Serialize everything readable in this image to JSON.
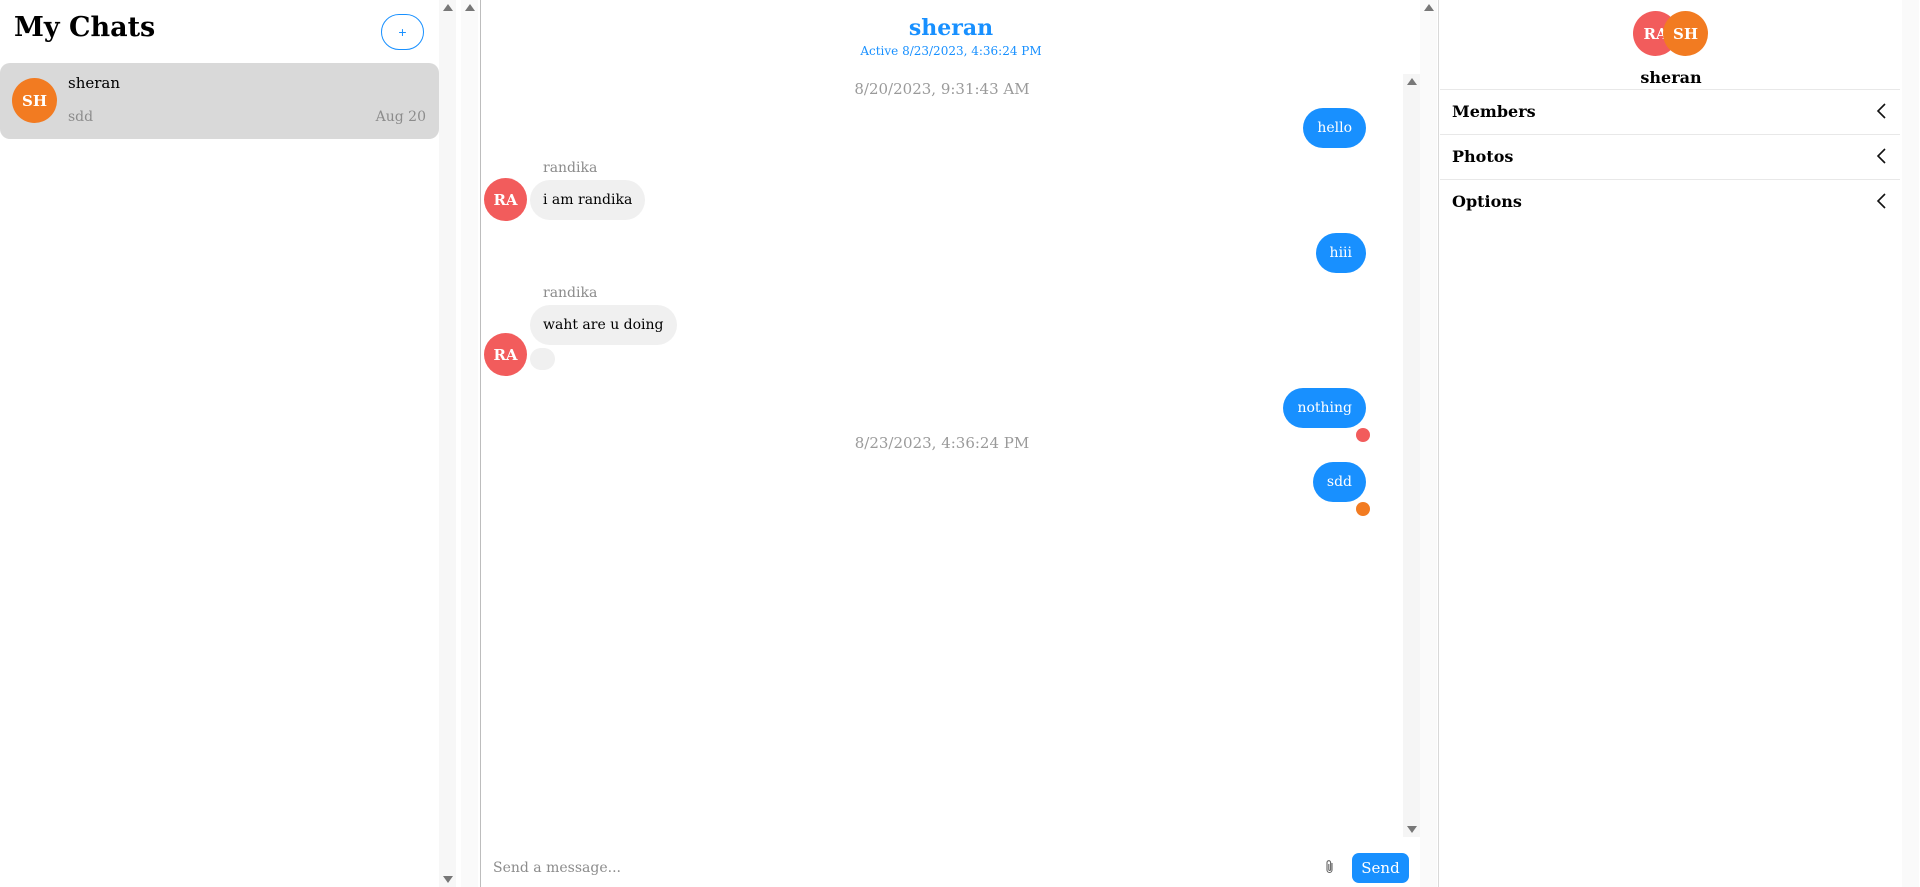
{
  "left_panel": {
    "title": "My Chats",
    "new_chat_label": "+",
    "chats": [
      {
        "initials": "SH",
        "name": "sheran",
        "last_message": "sdd",
        "date": "Aug 20",
        "avatar_color": "#f27b21"
      }
    ]
  },
  "conversation": {
    "name": "sheran",
    "status": "Active 8/23/2023, 4:36:24 PM",
    "timestamps": [
      "8/20/2023, 9:31:43 AM",
      "8/23/2023, 4:36:24 PM"
    ],
    "messages": [
      {
        "from": "me",
        "text": "hello"
      },
      {
        "from": "randika",
        "sender_label": "randika",
        "initials": "RA",
        "text": "i am randika"
      },
      {
        "from": "me",
        "text": "hiii"
      },
      {
        "from": "randika",
        "sender_label": "randika",
        "initials": "RA",
        "text": "waht are u doing"
      },
      {
        "from": "me",
        "text": "nothing"
      },
      {
        "from": "me",
        "text": "sdd"
      }
    ],
    "composer": {
      "placeholder": "Send a message...",
      "send_label": "Send"
    }
  },
  "right_panel": {
    "avatars": [
      "RA",
      "SH"
    ],
    "name": "sheran",
    "sections": [
      "Members",
      "Photos",
      "Options"
    ]
  },
  "colors": {
    "accent": "#1890ff",
    "avatar_ra": "#f25c5c",
    "avatar_sh": "#f27b21",
    "selected_chat": "#d9d9d9",
    "incoming_bubble": "#f0f0f0"
  },
  "icons": [
    "plus-icon",
    "attach-icon",
    "chevron-left-icon",
    "scroll-up-arrow",
    "scroll-down-arrow"
  ]
}
